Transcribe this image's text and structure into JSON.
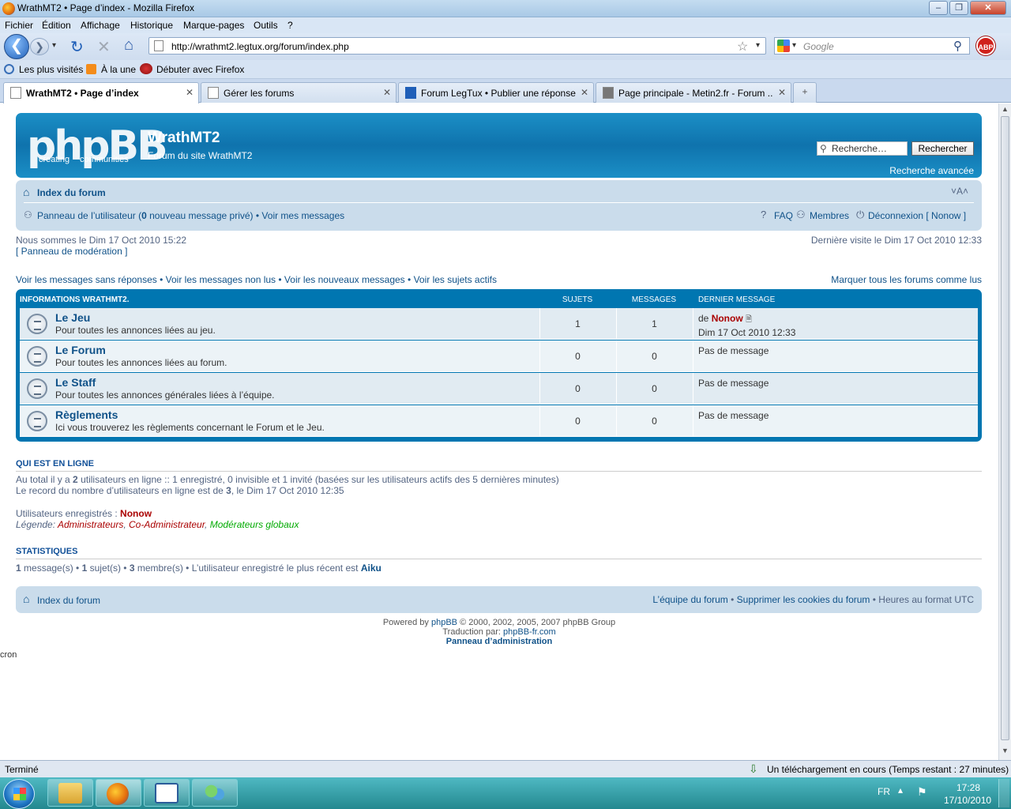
{
  "window": {
    "title": "WrathMT2 • Page d’index - Mozilla Firefox"
  },
  "menu": [
    "Fichier",
    "Édition",
    "Affichage",
    "Historique",
    "Marque-pages",
    "Outils",
    "?"
  ],
  "navbar": {
    "url": "http://wrathmt2.legtux.org/forum/index.php",
    "search_placeholder": "Google"
  },
  "bookmarks": [
    "Les plus visités",
    "À la une",
    "Débuter avec Firefox"
  ],
  "tabs": [
    {
      "label": "WrathMT2 • Page d’index",
      "active": true
    },
    {
      "label": "Gérer les forums",
      "active": false
    },
    {
      "label": "Forum LegTux • Publier une réponse",
      "active": false
    },
    {
      "label": "Page principale - Metin2.fr - Forum ...",
      "active": false
    }
  ],
  "header": {
    "logo_text": "phpBB",
    "logo_sub1": "creating",
    "logo_sub2": "communities",
    "site_name": "WrathMT2",
    "site_desc": "Forum du site WrathMT2",
    "search_placeholder": "Recherche…",
    "search_button": "Rechercher",
    "advanced_search": "Recherche avancée"
  },
  "navbox": {
    "breadcrumb": "Index du forum",
    "font_size_toggle": "˅A˄",
    "user_panel": "Panneau de l’utilisateur",
    "pm_open": " (",
    "pm_count": "0",
    "pm_text": " nouveau message privé) •",
    "view_messages": "Voir mes messages",
    "faq": "FAQ",
    "members": "Membres",
    "logout": "Déconnexion [ Nonow ]"
  },
  "info": {
    "current_time": "Nous sommes le Dim 17 Oct 2010 15:22",
    "mod_panel": "[ Panneau de modération ]",
    "last_visit": "Dernière visite le Dim 17 Oct 2010 12:33"
  },
  "quicklinks": {
    "unanswered": "Voir les messages sans réponses",
    "unread": "Voir les messages non lus",
    "new": "Voir les nouveaux messages",
    "active": "Voir les sujets actifs",
    "mark_read": "Marquer tous les forums comme lus"
  },
  "forum_table": {
    "header_cat": "Informations WrathMT2.",
    "header_topics": "Sujets",
    "header_posts": "Messages",
    "header_last": "Dernier message",
    "rows": [
      {
        "name": "Le Jeu",
        "desc": "Pour toutes les annonces liées au jeu.",
        "topics": "1",
        "posts": "1",
        "last_by_prefix": "de ",
        "last_by": "Nonow",
        "last_date": "Dim 17 Oct 2010 12:33"
      },
      {
        "name": "Le Forum",
        "desc": "Pour toutes les annonces liées au forum.",
        "topics": "0",
        "posts": "0",
        "last": "Pas de message"
      },
      {
        "name": "Le Staff",
        "desc": "Pour toutes les annonces générales liées à l’équipe.",
        "topics": "0",
        "posts": "0",
        "last": "Pas de message"
      },
      {
        "name": "Règlements",
        "desc": "Ici vous trouverez les règlements concernant le Forum et le Jeu.",
        "topics": "0",
        "posts": "0",
        "last": "Pas de message"
      }
    ]
  },
  "online": {
    "title": "Qui est en ligne",
    "line1_a": "Au total il y a ",
    "line1_count": "2",
    "line1_b": " utilisateurs en ligne :: 1 enregistré, 0 invisible et 1 invité (basées sur les utilisateurs actifs des 5 dernières minutes)",
    "line2_a": "Le record du nombre d’utilisateurs en ligne est de ",
    "line2_count": "3",
    "line2_b": ", le Dim 17 Oct 2010 12:35",
    "registered_label": "Utilisateurs enregistrés : ",
    "registered_user": "Nonow",
    "legend_label": "Légende: ",
    "legend_admin": "Administrateurs",
    "legend_coadmin": "Co-Administrateur",
    "legend_mod": "Modérateurs globaux",
    "admin_color": "#AA0000",
    "mod_color": "#00AA00"
  },
  "stats": {
    "title": "Statistiques",
    "messages": "1",
    "messages_label": " message(s) • ",
    "topics": "1",
    "topics_label": " sujet(s) • ",
    "members": "3",
    "members_label": " membre(s) • L’utilisateur enregistré le plus récent est ",
    "newest": "Aiku"
  },
  "footer": {
    "breadcrumb": "Index du forum",
    "team": "L’équipe du forum",
    "delete_cookies": "Supprimer les cookies du forum",
    "timezone": "Heures au format UTC",
    "powered_a": "Powered by ",
    "powered_link": "phpBB",
    "powered_b": " © 2000, 2002, 2005, 2007 phpBB Group",
    "translation_a": "Traduction par: ",
    "translation_link": "phpBB-fr.com",
    "admin_panel": "Panneau d’administration",
    "cron": "cron"
  },
  "statusbar": {
    "left": "Terminé",
    "right": "Un téléchargement en cours (Temps restant : 27 minutes)"
  },
  "taskbar": {
    "lang": "FR",
    "time": "17:28",
    "date": "17/10/2010"
  }
}
